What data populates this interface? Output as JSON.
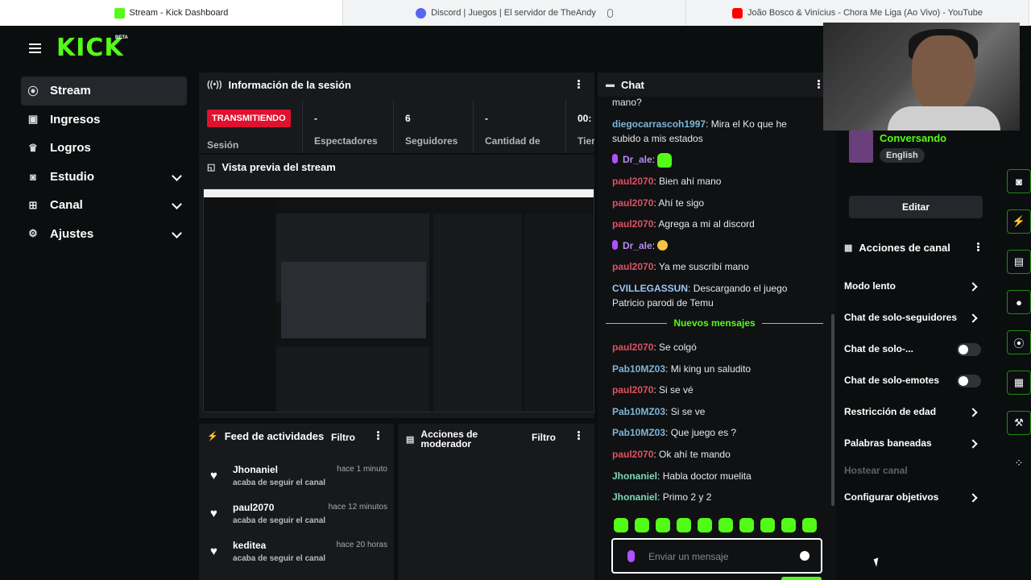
{
  "browser": {
    "tabs": [
      {
        "title": "Stream - Kick Dashboard",
        "favicon": "kick-icon"
      },
      {
        "title": "Discord | Juegos | El servidor de TheAndy",
        "favicon": "discord-icon"
      },
      {
        "title": "João Bosco & Vinícius - Chora Me Liga (Ao Vivo) - YouTube",
        "favicon": "youtube-icon"
      }
    ]
  },
  "brand": {
    "logo": "KICK",
    "beta": "BETA",
    "accent": "#53fc18"
  },
  "sidebar": {
    "items": [
      {
        "label": "Stream",
        "icon": "stream-icon"
      },
      {
        "label": "Ingresos",
        "icon": "revenue-icon"
      },
      {
        "label": "Logros",
        "icon": "trophy-icon"
      },
      {
        "label": "Estudio",
        "icon": "studio-icon"
      },
      {
        "label": "Canal",
        "icon": "channel-icon"
      },
      {
        "label": "Ajustes",
        "icon": "gear-icon"
      }
    ]
  },
  "session": {
    "title": "Información de la sesión",
    "status": "TRANSMITIENDO",
    "session_label": "Sesión",
    "stats": [
      {
        "value": "-",
        "label": "Espectadores"
      },
      {
        "value": "6",
        "label": "Seguidores"
      },
      {
        "value": "-",
        "label": "Cantidad de"
      },
      {
        "value": "00:",
        "label": "Tier"
      }
    ]
  },
  "preview": {
    "title": "Vista previa del stream"
  },
  "feed": {
    "title": "Feed de actividades",
    "filter": "Filtro",
    "items": [
      {
        "name": "Jhonaniel",
        "time": "hace 1 minuto",
        "desc": "acaba de seguir el canal"
      },
      {
        "name": "paul2070",
        "time": "hace 12 minutos",
        "desc": "acaba de seguir el canal"
      },
      {
        "name": "keditea",
        "time": "hace 20 horas",
        "desc": "acaba de seguir el canal"
      }
    ]
  },
  "moderator": {
    "title_line1": "Acciones de",
    "title_line2": "moderador",
    "filter": "Filtro"
  },
  "chat": {
    "title": "Chat",
    "new_messages": "Nuevos mensajes",
    "input_placeholder": "Enviar un mensaje",
    "messages": [
      {
        "user": "",
        "text": "mano?"
      },
      {
        "user": "diegocarrascoh1997",
        "text": "Mira el Ko que he subido a mis estados"
      },
      {
        "user": "Dr_ale",
        "text": ""
      },
      {
        "user": "paul2070",
        "text": "Bien ahí mano"
      },
      {
        "user": "paul2070",
        "text": "Ahí te sigo"
      },
      {
        "user": "paul2070",
        "text": "Agrega a mi al discord"
      },
      {
        "user": "Dr_ale",
        "text": ""
      },
      {
        "user": "paul2070",
        "text": "Ya me suscribí mano"
      },
      {
        "user": "CVILLEGASSUN",
        "text": "Descargando el juego Patricio parodi de Temu"
      },
      {
        "user": "paul2070",
        "text": "Se colgó"
      },
      {
        "user": "Pab10MZ03",
        "text": "Mi king un saludito"
      },
      {
        "user": "paul2070",
        "text": "Si se vé"
      },
      {
        "user": "Pab10MZ03",
        "text": "Si se ve"
      },
      {
        "user": "Pab10MZ03",
        "text": "Que juego es ?"
      },
      {
        "user": "paul2070",
        "text": "Ok ahí te mando"
      },
      {
        "user": "Jhonaniel",
        "text": "Habla doctor muelita"
      },
      {
        "user": "Jhonaniel",
        "text": "Primo 2 y 2"
      }
    ]
  },
  "stream_info": {
    "category": "Conversando",
    "tag": "English",
    "edit": "Editar"
  },
  "channel_actions": {
    "title": "Acciones de canal",
    "items": [
      {
        "label": "Modo lento"
      },
      {
        "label": "Chat de solo-seguidores"
      },
      {
        "label": "Chat de solo-..."
      },
      {
        "label": "Chat de solo-emotes"
      },
      {
        "label": "Restricción de edad"
      },
      {
        "label": "Palabras baneadas"
      },
      {
        "label": "Hostear canal"
      },
      {
        "label": "Configurar objetivos"
      }
    ]
  }
}
